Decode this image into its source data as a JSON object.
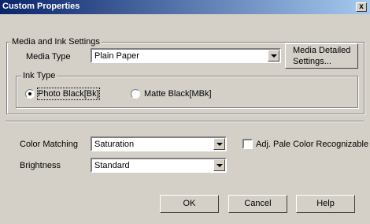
{
  "window": {
    "title": "Custom Properties",
    "close_label": "x"
  },
  "media_group": {
    "legend": "Media and Ink Settings",
    "media_type_label": "Media Type",
    "media_type_value": "Plain Paper",
    "detailed_button_line1": "Media Detailed",
    "detailed_button_line2": "Settings..."
  },
  "ink_group": {
    "legend": "Ink Type",
    "options": [
      {
        "label": "Photo Black[Bk]",
        "selected": true
      },
      {
        "label": "Matte Black[MBk]",
        "selected": false
      }
    ]
  },
  "color_matching": {
    "label": "Color Matching",
    "value": "Saturation"
  },
  "brightness": {
    "label": "Brightness",
    "value": "Standard"
  },
  "adj_pale": {
    "label": "Adj. Pale Color Recognizable",
    "checked": false
  },
  "buttons": {
    "ok": "OK",
    "cancel": "Cancel",
    "help": "Help"
  }
}
